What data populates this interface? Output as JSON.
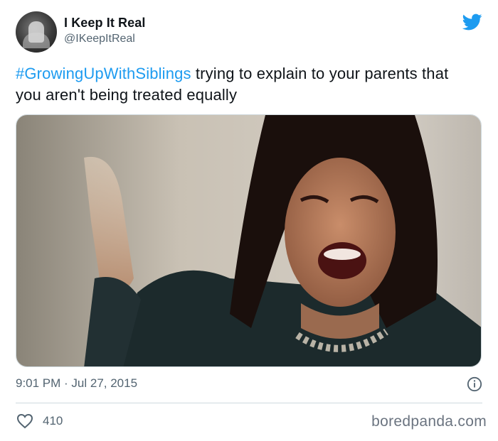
{
  "tweet": {
    "display_name": "I Keep It Real",
    "handle": "@IKeepItReal",
    "hashtag": "#GrowingUpWithSiblings",
    "text": " trying to explain to your parents that you aren't being treated equally",
    "timestamp": "9:01 PM · Jul 27, 2015",
    "like_count": "410"
  },
  "watermark": "boredpanda.com",
  "colors": {
    "twitter_blue": "#1d9bf0",
    "secondary_text": "#536471",
    "divider": "#cfd9de"
  },
  "icons": {
    "brand": "twitter-bird-icon",
    "info": "info-icon",
    "like": "heart-icon"
  }
}
